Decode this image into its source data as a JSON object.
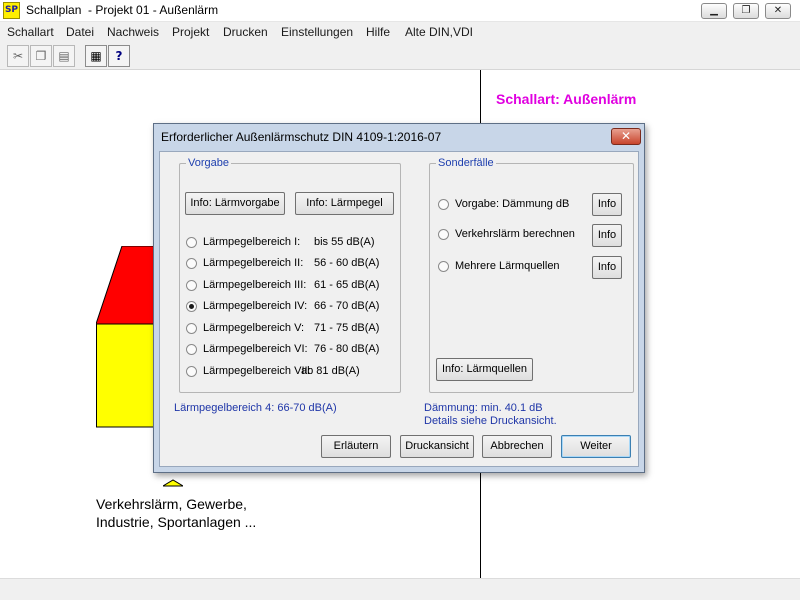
{
  "window": {
    "logo_text": "SP",
    "title": "Schallplan  - Projekt 01 - Außenlärm",
    "minimize_glyph": "▁",
    "maximize_glyph": "❐",
    "close_glyph": "✕"
  },
  "menu": [
    "Schallart",
    "Datei",
    "Nachweis",
    "Projekt",
    "Drucken",
    "Einstellungen",
    "Hilfe",
    "Alte DIN,VDI"
  ],
  "toolbar": [
    {
      "icon": "scissors-icon",
      "glyph": "✂",
      "enabled": false
    },
    {
      "icon": "copy-icon",
      "glyph": "❐",
      "enabled": false
    },
    {
      "icon": "paste-icon",
      "glyph": "▤",
      "enabled": false
    },
    {
      "icon": "properties-icon",
      "glyph": "▦",
      "enabled": true
    },
    {
      "icon": "context-help-icon",
      "glyph": "?",
      "enabled": true
    }
  ],
  "document": {
    "heading": "Schallart: Außenlärm",
    "caption_line1": "Verkehrslärm, Gewerbe,",
    "caption_line2": "Industrie, Sportanlagen ..."
  },
  "dialog": {
    "title": "Erforderlicher Außenlärmschutz DIN 4109-1:2016-07",
    "close_glyph": "✕",
    "vorgabe": {
      "legend": "Vorgabe",
      "btn_laermvorgabe": "Info: Lärmvorgabe",
      "btn_laermpegel": "Info: Lärmpegel",
      "options": [
        {
          "label": "Lärmpegelbereich I:",
          "range": "bis 55   dB(A)",
          "checked": false
        },
        {
          "label": "Lärmpegelbereich II:",
          "range": "56 - 60 dB(A)",
          "checked": false
        },
        {
          "label": "Lärmpegelbereich III:",
          "range": "61 - 65 dB(A)",
          "checked": false
        },
        {
          "label": "Lärmpegelbereich IV:",
          "range": "66 - 70 dB(A)",
          "checked": true
        },
        {
          "label": "Lärmpegelbereich V:",
          "range": "71 - 75 dB(A)",
          "checked": false
        },
        {
          "label": "Lärmpegelbereich VI:",
          "range": "76 - 80 dB(A)",
          "checked": false
        },
        {
          "label": "Lärmpegelbereich VII:",
          "range": "ab 81 dB(A)",
          "checked": false
        }
      ],
      "summary": "Lärmpegelbereich 4:  66-70 dB(A)"
    },
    "sonderfaelle": {
      "legend": "Sonderfälle",
      "options": [
        {
          "label": "Vorgabe: Dämmung dB",
          "info": "Info",
          "checked": false
        },
        {
          "label": "Verkehrslärm berechnen",
          "info": "Info",
          "checked": false
        },
        {
          "label": "Mehrere Lärmquellen",
          "info": "Info",
          "checked": false
        }
      ],
      "btn_laermquellen": "Info: Lärmquellen",
      "summary_line1": "Dämmung: min. 40.1 dB",
      "summary_line2": "Details siehe Druckansicht."
    },
    "buttons": {
      "erlaeutern": "Erläutern",
      "druckansicht": "Druckansicht",
      "abbrechen": "Abbrechen",
      "weiter": "Weiter"
    }
  },
  "colors": {
    "heading": "#e000e0",
    "roof": "#ff0000",
    "wall": "#ffff00",
    "group_legend": "#1e3fae",
    "info_text": "#1f36a8"
  }
}
